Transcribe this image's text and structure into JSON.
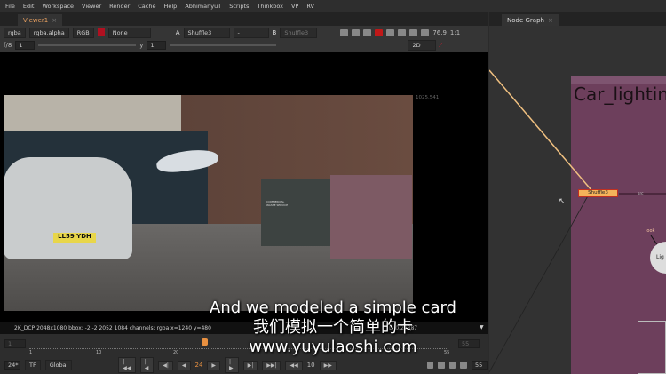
{
  "menu": [
    "File",
    "Edit",
    "Workspace",
    "Viewer",
    "Render",
    "Cache",
    "Help",
    "AbhimanyuT",
    "Scripts",
    "Thinkbox",
    "VP",
    "RV"
  ],
  "viewer": {
    "tab": "Viewer1",
    "channels": "rgba",
    "alpha": "rgba.alpha",
    "display": "RGB",
    "lut": "None",
    "input_a_label": "A",
    "input_a": "Shuffle3",
    "input_a_op": "-",
    "input_b_label": "B",
    "input_b": "Shuffle3",
    "zoom": "76.9",
    "ratio": "1:1",
    "fstop": "f/8",
    "gain": "1",
    "gamma_label": "y",
    "gamma": "1",
    "mode": "2D",
    "bbox_label": "1025,541"
  },
  "info": {
    "text": "2K_DCP 2048x1080  bbox: -2 -2 2052 1084 channels: rgba  x=1240 y=480",
    "luminance": "L: 0.27387"
  },
  "timeline": {
    "start": "1",
    "end": "55",
    "ticks": [
      "1",
      "10",
      "20",
      "55"
    ],
    "current": "24",
    "left_field": "1",
    "right_field": "55",
    "progress": 0.42
  },
  "transport": {
    "fps": "24*",
    "tf": "TF",
    "scope": "Global",
    "frame": "24",
    "step": "10",
    "end": "55"
  },
  "nodegraph": {
    "tab": "Node Graph",
    "backdrop_label": "Car_lightin",
    "node": "Shuffle3",
    "edge_label": "src",
    "input_label": "look",
    "light_node": "Lig",
    "backdrop_color": "#6d3f5c",
    "node_color": "#f5b35a"
  },
  "photo": {
    "plate": "LL59 YDH",
    "sign": "COMMERCIAL WASTE SERVICE"
  },
  "subtitle": {
    "en": "And we modeled a simple card",
    "zh": "我们模拟一个简单的卡",
    "url": "www.yuyulaoshi.com"
  }
}
